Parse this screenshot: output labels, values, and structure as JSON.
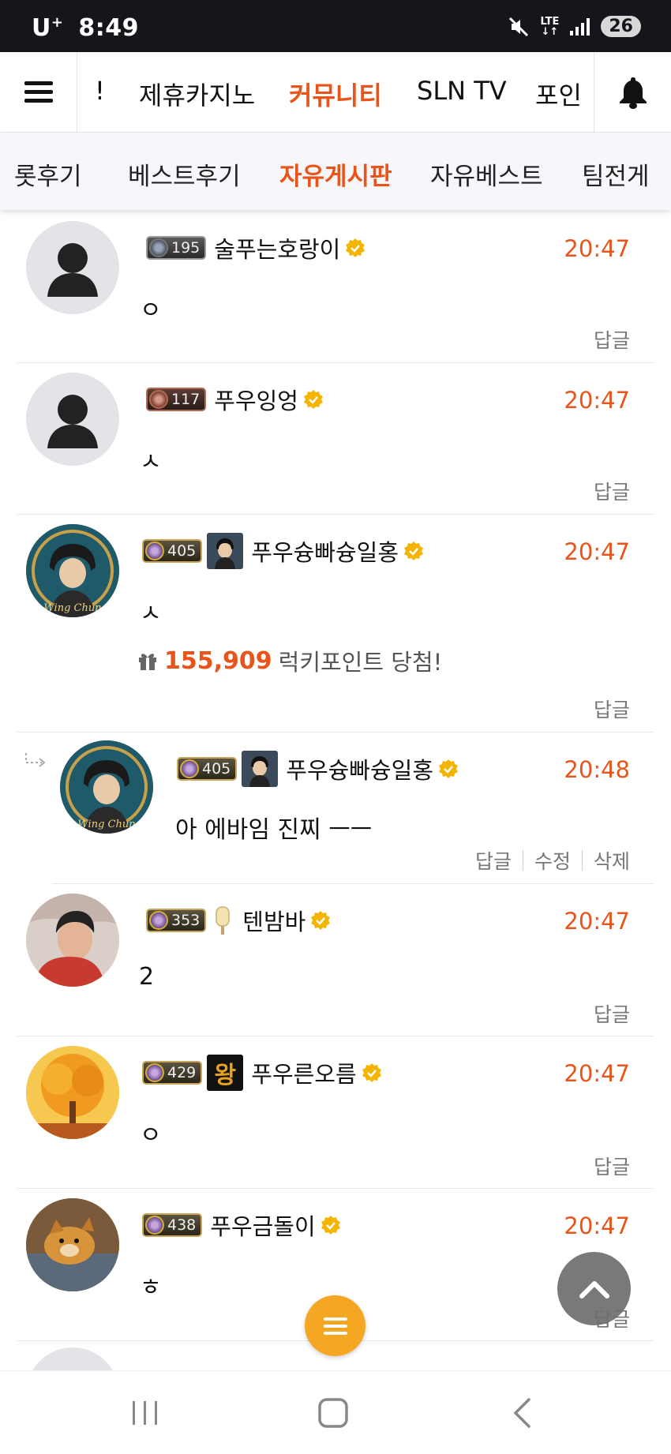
{
  "status_bar": {
    "carrier": "U",
    "carrier_sup": "+",
    "time": "8:49",
    "network_top": "LTE",
    "network_bottom": "↓↑",
    "battery": "26"
  },
  "top_nav": {
    "tabs": [
      {
        "label": "!"
      },
      {
        "label": "제휴카지노"
      },
      {
        "label": "커뮤니티"
      },
      {
        "label": "SLN TV"
      },
      {
        "label": "포인"
      }
    ],
    "active_color": "#e8541a"
  },
  "sub_nav": {
    "tabs": [
      {
        "label": "롯후기"
      },
      {
        "label": "베스트후기"
      },
      {
        "label": "자유게시판"
      },
      {
        "label": "자유베스트"
      },
      {
        "label": "팀전게"
      }
    ]
  },
  "comments": [
    {
      "level": "195",
      "nick": "술푸는호랑이",
      "time": "20:47",
      "text": "ㅇ",
      "reply": "답글"
    },
    {
      "level": "117",
      "nick": "푸우잉엉",
      "time": "20:47",
      "text": "ㅅ",
      "reply": "답글"
    },
    {
      "level": "405",
      "nick": "푸우슝빠슝일홍",
      "time": "20:47",
      "text": "ㅅ",
      "lucky_amount": "155,909",
      "lucky_text": "럭키포인트 당첨!",
      "reply": "답글",
      "avatar_caption": "Wing Chun"
    },
    {
      "level": "405",
      "nick": "푸우슝빠슝일홍",
      "time": "20:48",
      "text": "아 에바임 진찌 ㅡㅡ",
      "reply": "답글",
      "edit": "수정",
      "delete": "삭제",
      "avatar_caption": "Wing Chun"
    },
    {
      "level": "353",
      "nick": "텐밤바",
      "time": "20:47",
      "text": "2",
      "reply": "답글"
    },
    {
      "level": "429",
      "badge_text": "왕",
      "nick": "푸우른오름",
      "time": "20:47",
      "text": "ㅇ",
      "reply": "답글"
    },
    {
      "level": "438",
      "nick": "푸우금돌이",
      "time": "20:47",
      "text": "ㅎ",
      "reply": "답글"
    }
  ],
  "icons": {
    "menu": "hamburger-icon",
    "bell": "bell-icon",
    "verify": "verified-badge-icon",
    "gift": "gift-icon",
    "scroll_top": "chevron-up-icon",
    "fab_menu": "menu-icon"
  },
  "colors": {
    "accent": "#e8541a",
    "fab": "#f5a623",
    "verify": "#f5b400"
  }
}
